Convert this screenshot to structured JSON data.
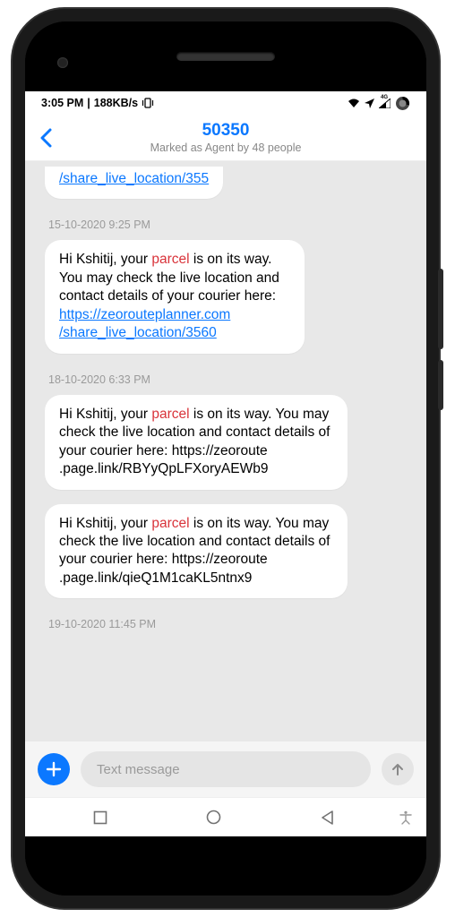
{
  "status": {
    "time": "3:05 PM",
    "net_speed": "188KB/s",
    "network_label": "4G"
  },
  "header": {
    "number": "50350",
    "subtitle": "Marked as Agent by 48 people"
  },
  "messages": {
    "partial_link": "/share_live_location/355",
    "ts1": "15-10-2020 9:25 PM",
    "m1_pre": "Hi Kshitij, your ",
    "m1_hl": "parcel",
    "m1_post": " is on its way. You may check the live location and contact details of your courier here: ",
    "m1_link1": "https://zeorouteplanner.com",
    "m1_link2": "/share_live_location/3560",
    "ts2": "18-10-2020 6:33 PM",
    "m2_pre": "Hi Kshitij, your ",
    "m2_hl": "parcel",
    "m2_post": " is on its way. You may check the live location and contact details of your courier here:  https://zeoroute .page.link/RBYyQpLFXoryAEWb9",
    "m3_pre": "Hi Kshitij, your ",
    "m3_hl": "parcel",
    "m3_post": " is on its way. You may check the live location and contact details of your courier here:  https://zeoroute .page.link/qieQ1M1caKL5ntnx9",
    "ts3": "19-10-2020 11:45 PM"
  },
  "input": {
    "placeholder": "Text message"
  }
}
